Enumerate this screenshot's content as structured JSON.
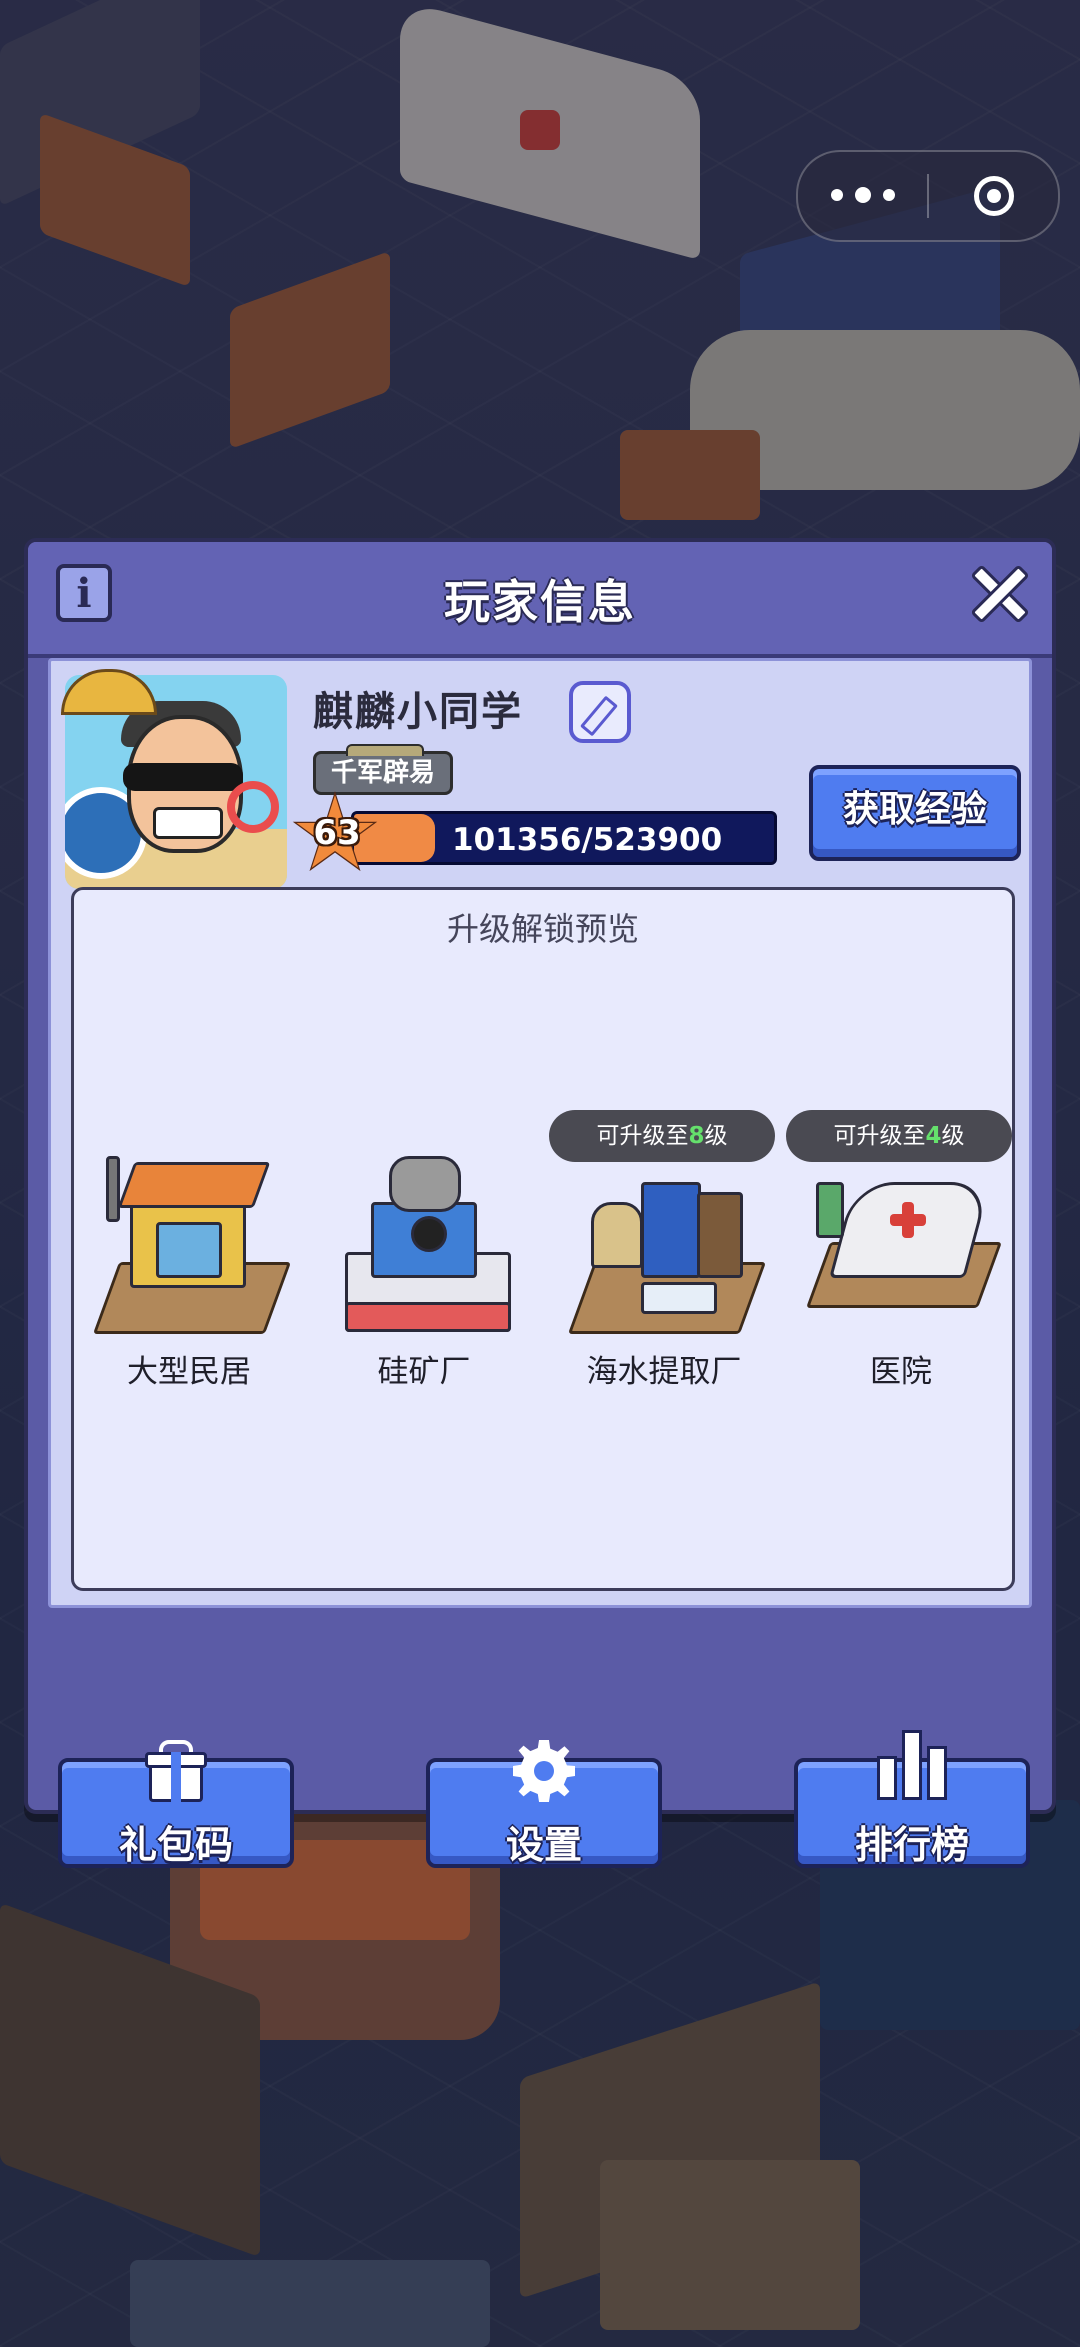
{
  "dialog": {
    "title": "玩家信息"
  },
  "player": {
    "name": "麒麟小同学",
    "title_badge": "千军辟易",
    "level": "63",
    "xp_text": "101356/523900",
    "xp_fraction": 0.193
  },
  "buttons": {
    "get_exp": "获取经验",
    "gift_code": "礼包码",
    "settings": "设置",
    "leaderboard": "排行榜"
  },
  "preview": {
    "title": "升级解锁预览",
    "buildings": [
      {
        "name": "大型民居",
        "badge": null
      },
      {
        "name": "硅矿厂",
        "badge": null
      },
      {
        "name": "海水提取厂",
        "badge": {
          "prefix": "可升级至",
          "level": "8",
          "suffix": "级"
        }
      },
      {
        "name": "医院",
        "badge": {
          "prefix": "可升级至",
          "level": "4",
          "suffix": "级"
        }
      }
    ]
  },
  "colors": {
    "dialog_bg": "#5b5ba6",
    "button_blue": "#4f7cf0",
    "xp_fill": "#f08a45",
    "xp_track": "#10185c",
    "level_highlight": "#65e06c"
  }
}
